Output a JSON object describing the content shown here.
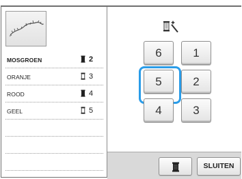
{
  "threads": [
    {
      "name": "MOSGROEN",
      "needle": "2",
      "filled": true,
      "selected": true
    },
    {
      "name": "ORANJE",
      "needle": "3",
      "filled": false,
      "selected": false
    },
    {
      "name": "ROOD",
      "needle": "4",
      "filled": true,
      "selected": false
    },
    {
      "name": "GEEL",
      "needle": "5",
      "filled": false,
      "selected": false
    }
  ],
  "needles": {
    "n6": "6",
    "n1": "1",
    "n5": "5",
    "n2": "2",
    "n4": "4",
    "n3": "3"
  },
  "selected_needle": "5",
  "buttons": {
    "close_label": "SLUITEN",
    "spool_icon": "thread-spool-icon"
  },
  "icons": {
    "top": "magic-wand-spool-icon"
  },
  "colors": {
    "selection": "#2a9ce8",
    "bottom_bar": "#d9d9d9"
  }
}
